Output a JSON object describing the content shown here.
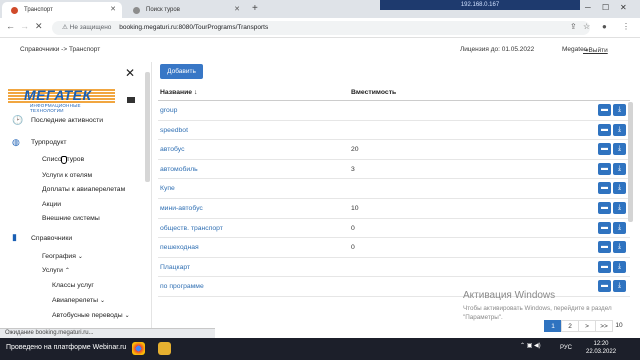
{
  "browser": {
    "tabs": [
      {
        "title": "Транспорт",
        "active": true
      },
      {
        "title": "Поиск туров",
        "active": false
      }
    ],
    "remote_host": "192.168.0.167",
    "insecure_label": "Не защищено",
    "url": "booking.megaturi.ru:8080/TourPrograms/Transports",
    "status": "Ожидание booking.megaturi.ru..."
  },
  "header": {
    "breadcrumb": "Справочники -> Транспорт",
    "license": "Лицензия до: 01.05.2022",
    "user": "Megatec",
    "logout": "Выйти"
  },
  "logo": {
    "word": "МЕГАТЕК",
    "sub": "ИНФОРМАЦИОННЫЕ ТЕХНОЛОГИИ"
  },
  "sidebar": {
    "recent": "Последние активности",
    "tour_product": "Турпродукт",
    "tour_items": [
      "Список туров",
      "Услуги к отелям",
      "Доплаты к авиаперелетам",
      "Акции",
      "Внешние системы"
    ],
    "directories": "Справочники",
    "geography": "География",
    "services": "Услуги",
    "service_items": [
      "Классы услуг",
      "Авиаперелеты",
      "Автобусные переводы"
    ]
  },
  "main": {
    "add_button": "Добавить",
    "col_name": "Название",
    "col_capacity": "Вместимость",
    "sort_indicator": "↓",
    "rows": [
      {
        "name": "group",
        "capacity": ""
      },
      {
        "name": "speedbot",
        "capacity": ""
      },
      {
        "name": "автобус",
        "capacity": "20"
      },
      {
        "name": "автомобиль",
        "capacity": "3"
      },
      {
        "name": "Купе",
        "capacity": ""
      },
      {
        "name": "мини-автобус",
        "capacity": "10"
      },
      {
        "name": "обществ. транспорт",
        "capacity": "0"
      },
      {
        "name": "пешеходная",
        "capacity": "0"
      },
      {
        "name": "Плацкарт",
        "capacity": ""
      },
      {
        "name": "по программе",
        "capacity": ""
      }
    ],
    "pager": [
      "1",
      "2",
      ">",
      ">>",
      "10"
    ]
  },
  "watermark": {
    "title": "Активация Windows",
    "text": "Чтобы активировать Windows, перейдите в раздел \"Параметры\"."
  },
  "taskbar": {
    "app": "Проведено на платформе Webinar.ru",
    "lang": "РУС",
    "time": "12:20",
    "date": "22.03.2022"
  },
  "colors": {
    "accent": "#3877c6",
    "link": "#2f6fb3",
    "logo": "#1a5fb4",
    "logo_orange": "#f1a640"
  }
}
